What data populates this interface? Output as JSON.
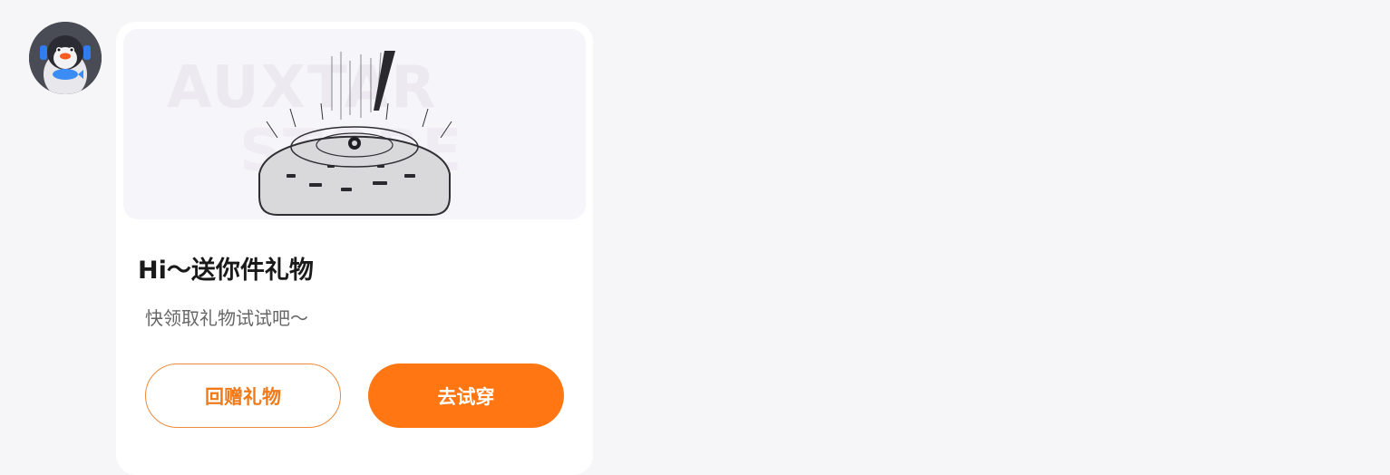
{
  "card": {
    "title": "Hi～送你件礼物",
    "subtitle": "快领取礼物试试吧～",
    "watermark_line1": "AUXTAR",
    "watermark_line2": "STORE"
  },
  "buttons": {
    "return_gift_label": "回赠礼物",
    "try_on_label": "去试穿"
  },
  "colors": {
    "accent": "#ff7612",
    "accent_outline": "#f08a3a",
    "page_bg": "#f6f5f7",
    "card_bg": "#ffffff"
  },
  "icons": {
    "avatar": "penguin-avatar",
    "item": "gift-item-preview"
  }
}
